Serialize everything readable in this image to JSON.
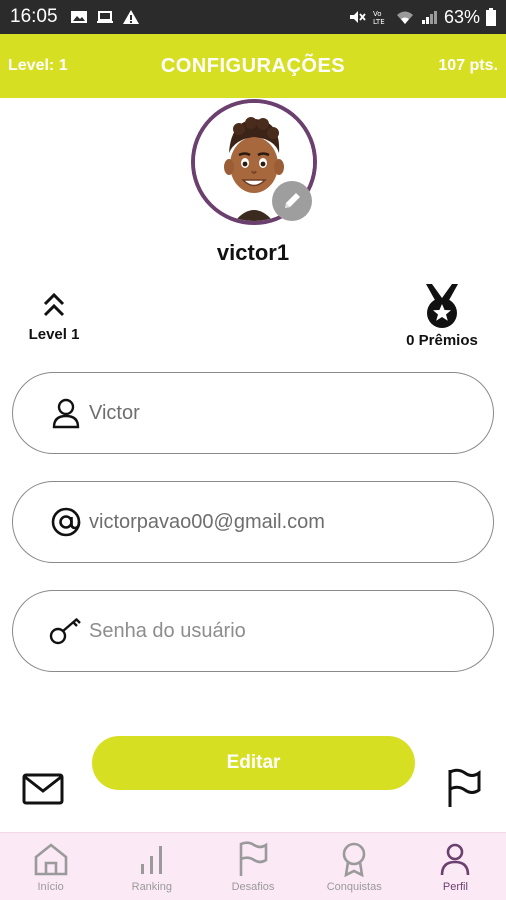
{
  "status_bar": {
    "time": "16:05",
    "battery": "63%",
    "icons": [
      "image-icon",
      "laptop-icon",
      "warning-icon",
      "mute-icon",
      "volte-icon",
      "wifi-icon",
      "signal-icon",
      "battery-icon"
    ]
  },
  "header": {
    "level": "Level: 1",
    "title": "CONFIGURAÇÕES",
    "points": "107 pts."
  },
  "profile": {
    "username": "victor1"
  },
  "stats": {
    "level_label": "Level 1",
    "prizes_label": "0 Prêmios"
  },
  "form": {
    "name_value": "Victor",
    "email_value": "victorpavao00@gmail.com",
    "password_placeholder": "Senha do usuário"
  },
  "actions": {
    "edit_label": "Editar"
  },
  "nav": {
    "items": [
      {
        "label": "Início",
        "icon": "home-icon"
      },
      {
        "label": "Ranking",
        "icon": "bar-chart-icon"
      },
      {
        "label": "Desafios",
        "icon": "flag-icon"
      },
      {
        "label": "Conquistas",
        "icon": "award-icon"
      },
      {
        "label": "Perfil",
        "icon": "user-icon"
      }
    ]
  },
  "colors": {
    "accent": "#d7df23",
    "purple": "#6b3f6e",
    "nav_bg": "#fbe9f6",
    "status_bar": "#2b2b2b"
  }
}
